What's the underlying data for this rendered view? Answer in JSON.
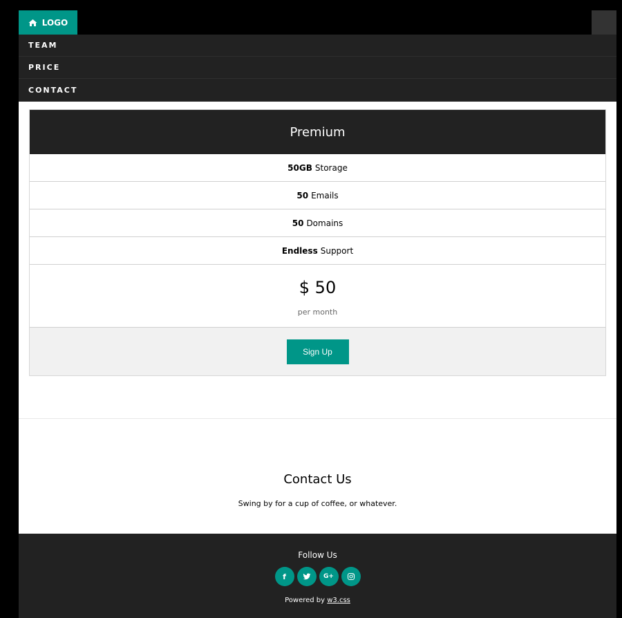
{
  "topbar": {
    "logo_label": "LOGO",
    "logo_icon": "home-icon",
    "menu_icon": "menu-toggle"
  },
  "nav": {
    "items": [
      {
        "label": "TEAM"
      },
      {
        "label": "PRICE"
      },
      {
        "label": "CONTACT"
      }
    ]
  },
  "pricing": {
    "plan": "Premium",
    "features": [
      {
        "bold": "50GB",
        "text": "Storage"
      },
      {
        "bold": "50",
        "text": "Emails"
      },
      {
        "bold": "50",
        "text": "Domains"
      },
      {
        "bold": "Endless",
        "text": "Support"
      }
    ],
    "price": "$ 50",
    "period": "per month",
    "signup_label": "Sign Up"
  },
  "contact": {
    "title": "Contact Us",
    "subtitle": "Swing by for a cup of coffee, or whatever."
  },
  "footer": {
    "follow_label": "Follow Us",
    "socials": [
      {
        "icon": "facebook-icon",
        "glyph": "f"
      },
      {
        "icon": "twitter-icon",
        "glyph": "🐦"
      },
      {
        "icon": "google-plus-icon",
        "glyph": "G+"
      },
      {
        "icon": "instagram-icon",
        "glyph": "◎"
      }
    ],
    "powered_prefix": "Powered by",
    "powered_link": "w3.css"
  },
  "colors": {
    "accent": "#009688",
    "dark": "#222222",
    "light_gray": "#f1f1f1"
  }
}
